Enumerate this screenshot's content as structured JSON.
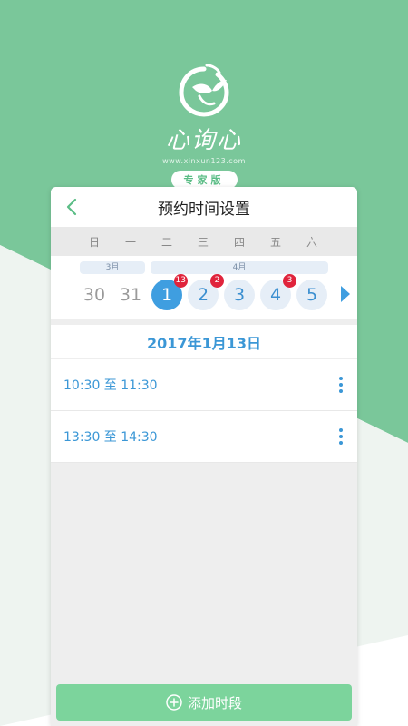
{
  "app": {
    "logo_title": "心询心",
    "logo_url": "www.xinxun123.com",
    "edition": "专家版"
  },
  "header": {
    "title": "预约时间设置"
  },
  "calendar": {
    "weekdays": [
      "日",
      "一",
      "二",
      "三",
      "四",
      "五",
      "六"
    ],
    "months": [
      {
        "label": "3月"
      },
      {
        "label": "4月"
      }
    ],
    "days": [
      {
        "label": "30",
        "state": "past"
      },
      {
        "label": "31",
        "state": "past"
      },
      {
        "label": "1",
        "state": "selected",
        "badge": "13"
      },
      {
        "label": "2",
        "state": "future",
        "badge": "2"
      },
      {
        "label": "3",
        "state": "future"
      },
      {
        "label": "4",
        "state": "future",
        "badge": "3"
      },
      {
        "label": "5",
        "state": "future"
      }
    ]
  },
  "selected_date": "2017年1月13日",
  "slots": [
    {
      "text": "10:30 至 11:30"
    },
    {
      "text": "13:30 至 14:30"
    }
  ],
  "add_button": {
    "label": "添加时段"
  },
  "colors": {
    "brand_green": "#7ac79a",
    "accent_blue": "#3b97d6",
    "badge_red": "#e0243c",
    "button_green": "#7cd49c"
  },
  "icons": {
    "back": "chevron-left-icon",
    "next": "triangle-right-icon",
    "more": "more-vertical-icon",
    "add": "plus-circle-icon",
    "logo": "bird-leaf-icon"
  }
}
